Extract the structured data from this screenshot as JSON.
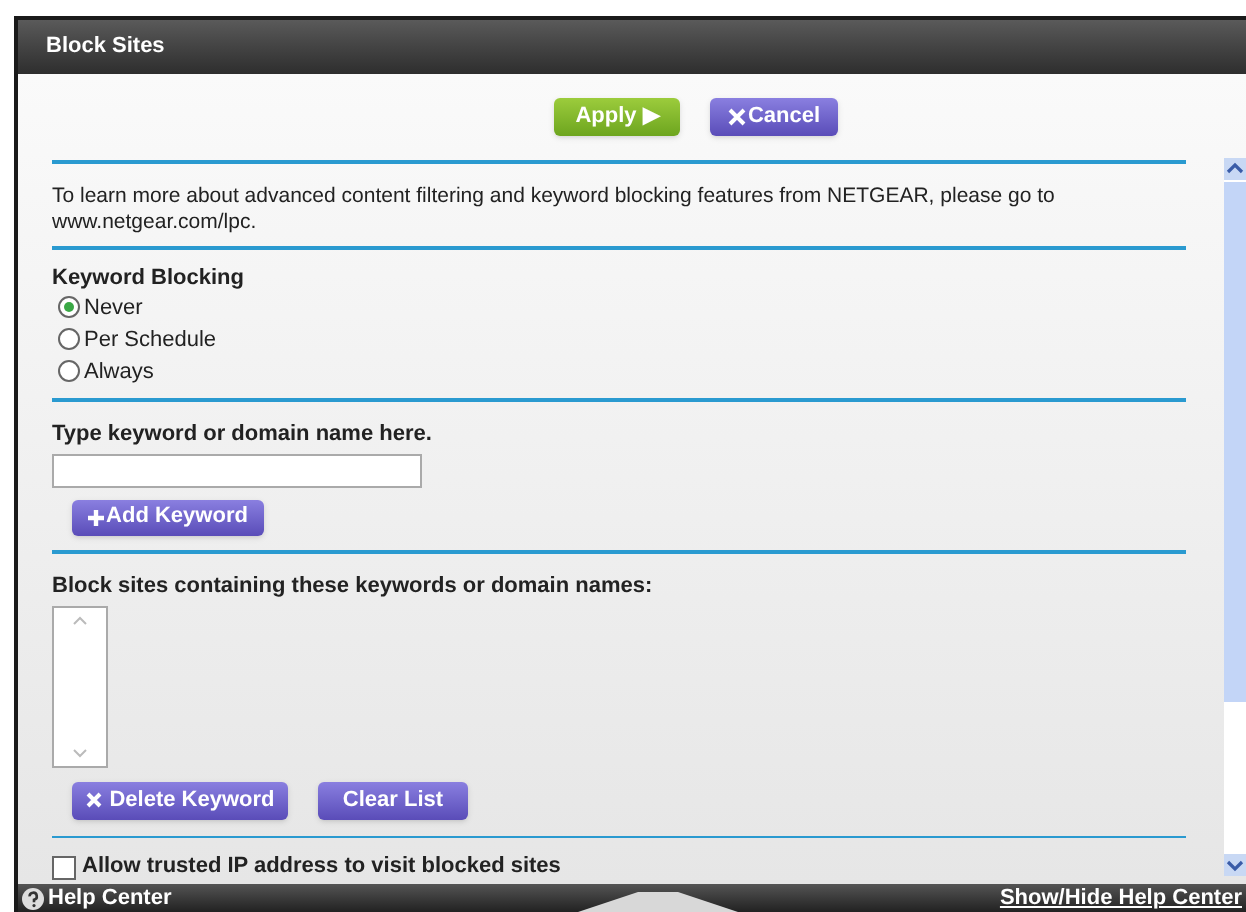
{
  "window": {
    "title": "Block Sites"
  },
  "actions": [
    {
      "kind": "apply",
      "label": "Apply ▶"
    },
    {
      "kind": "cancel",
      "label": "Cancel"
    }
  ],
  "intro": "To learn more about advanced content filtering and keyword blocking features from NETGEAR, please go to www.netgear.com/lpc.",
  "keyword_blocking": {
    "heading": "Keyword Blocking",
    "options": [
      {
        "label": "Never",
        "selected": true
      },
      {
        "label": "Per Schedule",
        "selected": false
      },
      {
        "label": "Always",
        "selected": false
      }
    ]
  },
  "keyword_entry": {
    "label": "Type keyword or domain name here.",
    "add_button": "Add Keyword"
  },
  "block_list": {
    "label": "Block sites containing these keywords or domain names:",
    "buttons": [
      {
        "kind": "delete",
        "label": "Delete Keyword"
      },
      {
        "kind": "clear",
        "label": "Clear List"
      }
    ]
  },
  "trusted_ip": {
    "label": "Allow trusted IP address to visit blocked sites",
    "checked": false
  },
  "footer": {
    "help": "Help Center",
    "toggle": "Show/Hide Help Center"
  }
}
